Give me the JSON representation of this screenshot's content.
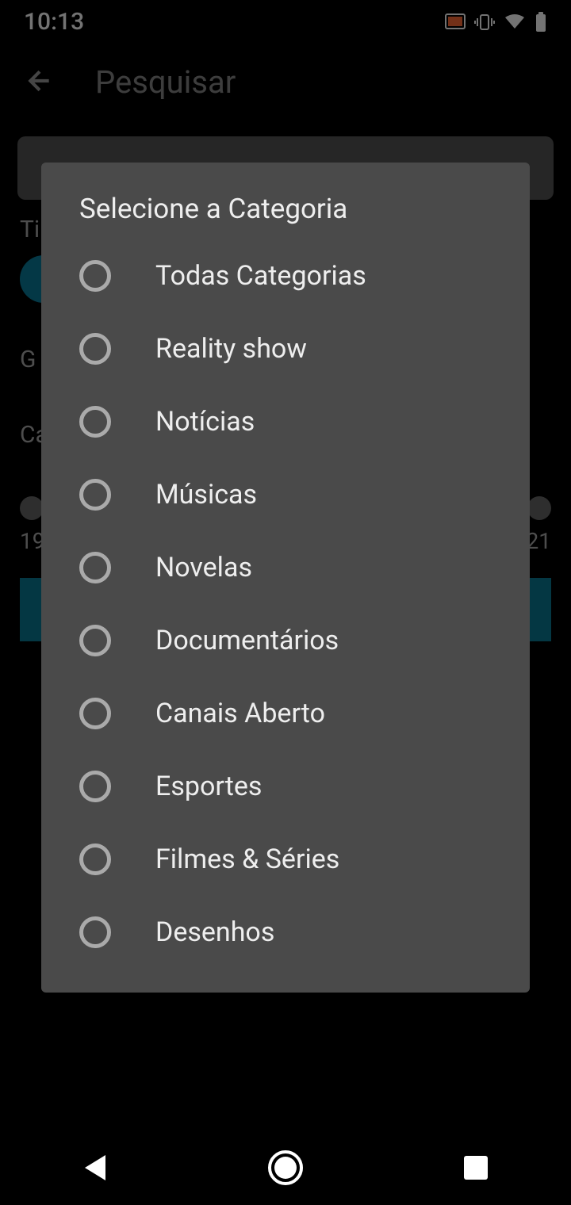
{
  "status": {
    "time": "10:13"
  },
  "header": {
    "title": "Pesquisar"
  },
  "background": {
    "type_label": "Ti",
    "genre_label": "G",
    "category_label": "Ca",
    "year_start": "19",
    "year_end": "21"
  },
  "dialog": {
    "title": "Selecione a Categoria",
    "options": [
      {
        "label": "Todas Categorias"
      },
      {
        "label": "Reality show"
      },
      {
        "label": "Notícias"
      },
      {
        "label": "Músicas"
      },
      {
        "label": "Novelas"
      },
      {
        "label": "Documentários"
      },
      {
        "label": "Canais Aberto"
      },
      {
        "label": "Esportes"
      },
      {
        "label": "Filmes & Séries"
      },
      {
        "label": "Desenhos"
      }
    ]
  }
}
